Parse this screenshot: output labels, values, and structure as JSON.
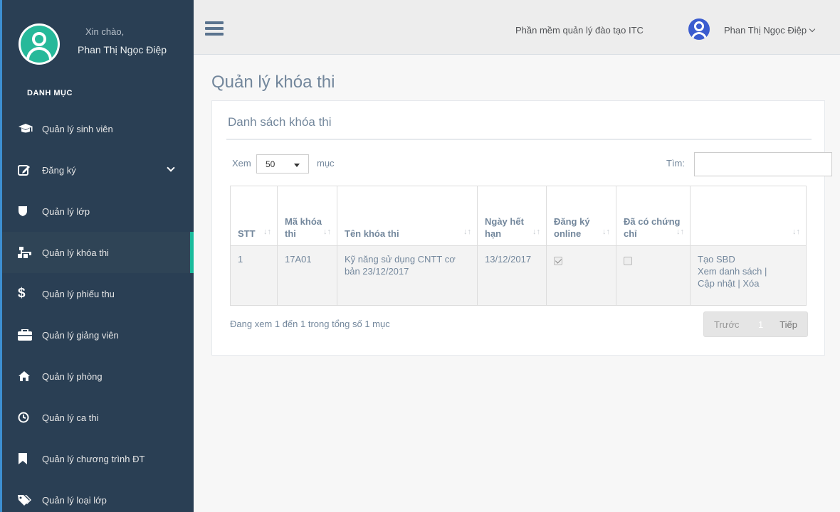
{
  "sidebar": {
    "greeting": "Xin chào,",
    "user_name": "Phan Thị Ngọc Điệp",
    "section_title": "DANH MỤC",
    "items": [
      {
        "label": "Quản lý sinh viên",
        "icon": "graduation-cap-icon"
      },
      {
        "label": "Đăng ký",
        "icon": "edit-icon"
      },
      {
        "label": "Quản lý lớp",
        "icon": "shield-icon"
      },
      {
        "label": "Quản lý khóa thi",
        "icon": "sitemap-icon",
        "active": true
      },
      {
        "label": "Quản lý phiếu thu",
        "icon": "dollar-icon"
      },
      {
        "label": "Quản lý giảng viên",
        "icon": "briefcase-icon"
      },
      {
        "label": "Quản lý phòng",
        "icon": "home-icon"
      },
      {
        "label": "Quản lý ca thi",
        "icon": "clock-icon"
      },
      {
        "label": "Quản lý chương trình ĐT",
        "icon": "bookmark-icon"
      },
      {
        "label": "Quản lý loại lớp",
        "icon": "tags-icon"
      }
    ]
  },
  "topnav": {
    "app_title": "Phần mềm quản lý đào tạo ITC",
    "user_name": "Phan Thị Ngọc Điệp"
  },
  "page": {
    "title": "Quản lý khóa thi"
  },
  "panel": {
    "title": "Danh sách khóa thi",
    "length_prefix": "Xem",
    "length_value": "50",
    "length_suffix": "mục",
    "search_label": "Tìm:",
    "search_value": ""
  },
  "table": {
    "headers": [
      "STT",
      "Mã khóa thi",
      "Tên khóa thi",
      "Ngày hết hạn",
      "Đăng ký online",
      "Đã có chứng chỉ",
      ""
    ],
    "rows": [
      {
        "stt": "1",
        "code": "17A01",
        "name": "Kỹ năng sử dụng CNTT cơ bản 23/12/2017",
        "expiry": "13/12/2017",
        "online": true,
        "certified": false,
        "actions": [
          "Tạo SBD",
          "Xem danh sách |",
          "Cập nhật | Xóa"
        ]
      }
    ]
  },
  "footer": {
    "info": "Đang xem 1 đến 1 trong tổng số 1 mục",
    "prev": "Trước",
    "page": "1",
    "next": "Tiếp"
  },
  "colors": {
    "sidebar_bg": "#2a3f54",
    "accent": "#1abb9c",
    "topnav_bg": "#ededed"
  }
}
